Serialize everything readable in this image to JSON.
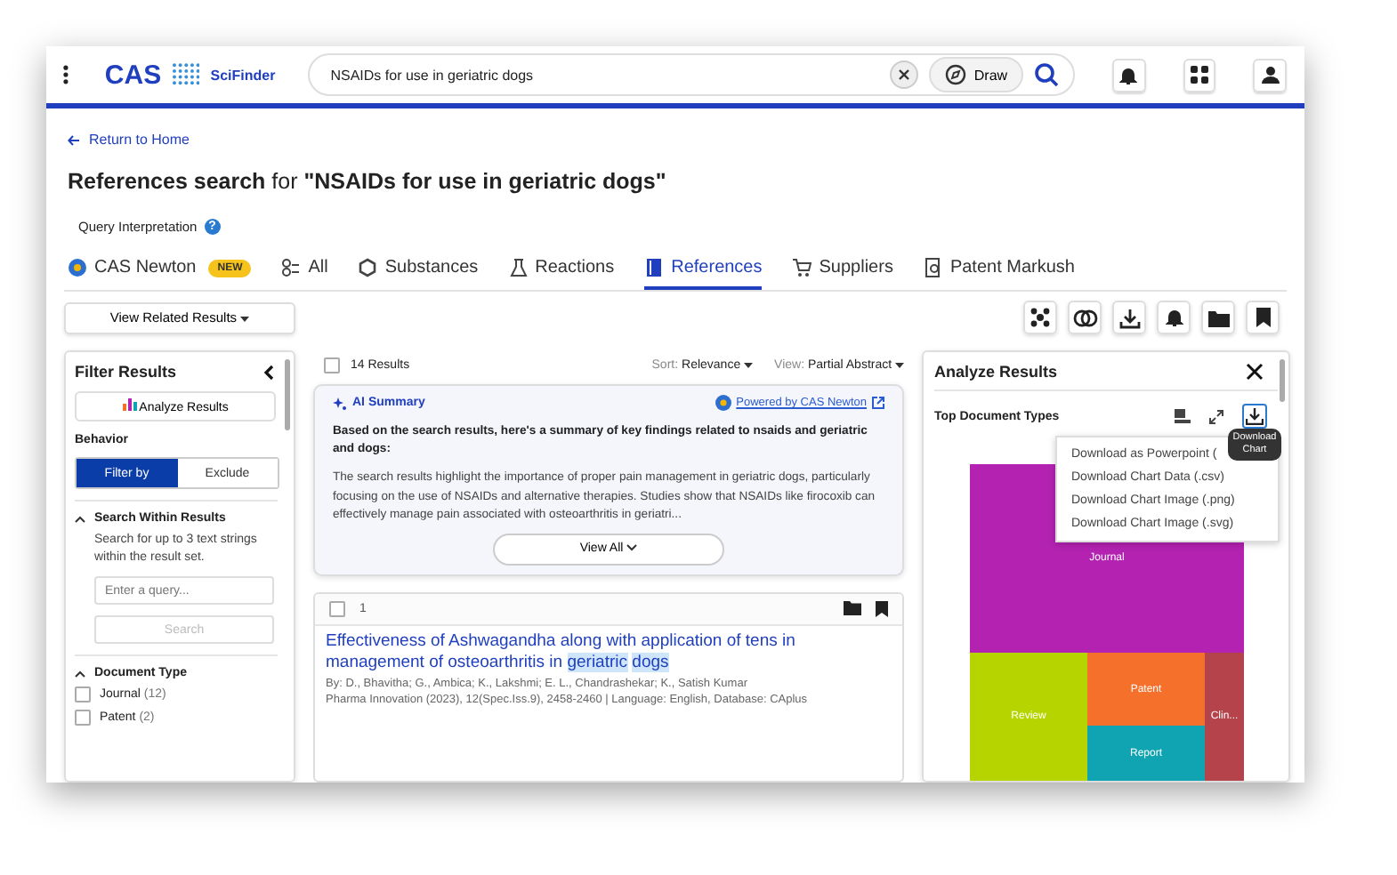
{
  "app_bar": {
    "logo": "CAS",
    "product": "SciFinder",
    "search": {
      "value": "NSAIDs for use in geriatric dogs"
    },
    "draw_button": "Draw"
  },
  "back_link": "Return to Home",
  "heading": {
    "prefix": "References search",
    "joiner": "for",
    "query": "\"NSAIDs for use in geriatric dogs\""
  },
  "query_interpretation": "Query Interpretation",
  "query_help": "?",
  "tabs": [
    {
      "label": "CAS Newton",
      "badge": "NEW",
      "kind": "newton",
      "selected": false
    },
    {
      "label": "All",
      "kind": "all",
      "selected": false
    },
    {
      "label": "Substances",
      "kind": "substances",
      "selected": false
    },
    {
      "label": "Reactions",
      "kind": "reactions",
      "selected": false
    },
    {
      "label": "References",
      "kind": "references",
      "selected": true
    },
    {
      "label": "Suppliers",
      "kind": "suppliers",
      "selected": false
    },
    {
      "label": "Patent Markush",
      "kind": "markush",
      "selected": false
    }
  ],
  "related_button": "View Related Results",
  "filter": {
    "title": "Filter Results",
    "analyze_button": "Analyze Results",
    "behavior_label": "Behavior",
    "behavior_options": [
      {
        "label": "Filter by",
        "selected": true
      },
      {
        "label": "Exclude",
        "selected": false
      }
    ],
    "search_within": {
      "title": "Search Within Results",
      "expanded": true,
      "hint": "Search for up to 3 text strings within the result set.",
      "placeholder": "Enter a query...",
      "button": "Search"
    },
    "document_type": {
      "title": "Document Type",
      "expanded": true,
      "options": [
        {
          "label": "Journal",
          "count": "(12)",
          "checked": false
        },
        {
          "label": "Patent",
          "count": "(2)",
          "checked": false
        }
      ]
    }
  },
  "results": {
    "select_all_checked": false,
    "count": "14 Results",
    "sort_label": "Sort:",
    "sort_value": "Relevance",
    "view_label": "View:",
    "view_value": "Partial Abstract",
    "ai_summary": {
      "title": "AI Summary",
      "powered_link": "Powered by CAS Newton",
      "lead": "Based on the search results, here's a summary of key findings related to nsaids and geriatric and dogs:",
      "body": "The search results highlight the importance of proper pain management in geriatric dogs, particularly focusing on the use of NSAIDs and alternative therapies. Studies show that NSAIDs like firocoxib can effectively manage pain associated with osteoarthritis in geriatri...",
      "button": "View All"
    },
    "items": [
      {
        "number": "1",
        "checked": false,
        "title": [
          {
            "text": "Effectiveness of Ashwagandha along with application of tens in management of osteoarthritis in",
            "highlight": false
          },
          {
            "text": "geriatric",
            "highlight": true
          },
          {
            "text": "dogs",
            "highlight": true
          }
        ],
        "authors": "By: D., Bhavitha; G., Ambica; K., Lakshmi; E. L., Chandrashekar; K., Satish Kumar",
        "source": "Pharma Innovation (2023), 12(Spec.Iss.9), 2458-2460 | Language: English, Database: CAplus"
      }
    ]
  },
  "analyze": {
    "title": "Analyze Results",
    "chart_title": "Top Document Types",
    "download_menu": [
      "Download as Powerpoint (",
      "Download Chart Data (.csv)",
      "Download Chart Image (.png)",
      "Download Chart Image (.svg)"
    ],
    "tooltip": "Download Chart",
    "treemap": [
      {
        "label": "Journal",
        "color": "#b322b1"
      },
      {
        "label": "Review",
        "color": "#b6d500"
      },
      {
        "label": "Patent",
        "color": "#f5702a"
      },
      {
        "label": "Report",
        "color": "#10a3b2"
      },
      {
        "label": "Clin...",
        "color": "#b4434b"
      }
    ]
  }
}
